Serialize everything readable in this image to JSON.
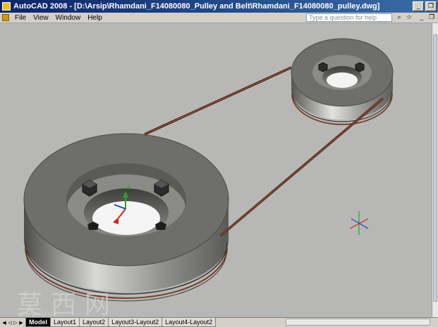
{
  "window": {
    "title": "AutoCAD 2008 - [D:\\Arsip\\Rhamdani_F14080080_Pulley and Belt\\Rhamdani_F14080080_pulley.dwg]",
    "buttons": {
      "minimize": "_",
      "restore": "❐"
    }
  },
  "menu": {
    "items": [
      "File",
      "View",
      "Window",
      "Help"
    ],
    "help_placeholder": "Type a question for help"
  },
  "layout_tabs": {
    "items": [
      "Model",
      "Layout1",
      "Layout2",
      "Layout3-Layout2",
      "Layout4-Layout2"
    ],
    "active": "Model"
  },
  "watermark": {
    "text": "莫西网",
    "url": "www.Mosi..."
  },
  "colors": {
    "titlebar_start": "#0a246a",
    "viewport_bg": "#b7b8b5",
    "pulley_face": "#6e6f6a",
    "belt": "#7a3a24"
  },
  "icons": [
    "app-icon",
    "document-icon",
    "search-icon",
    "star-icon",
    "minimize-icon",
    "restore-icon",
    "ucs-icon",
    "gizmo-icon"
  ]
}
